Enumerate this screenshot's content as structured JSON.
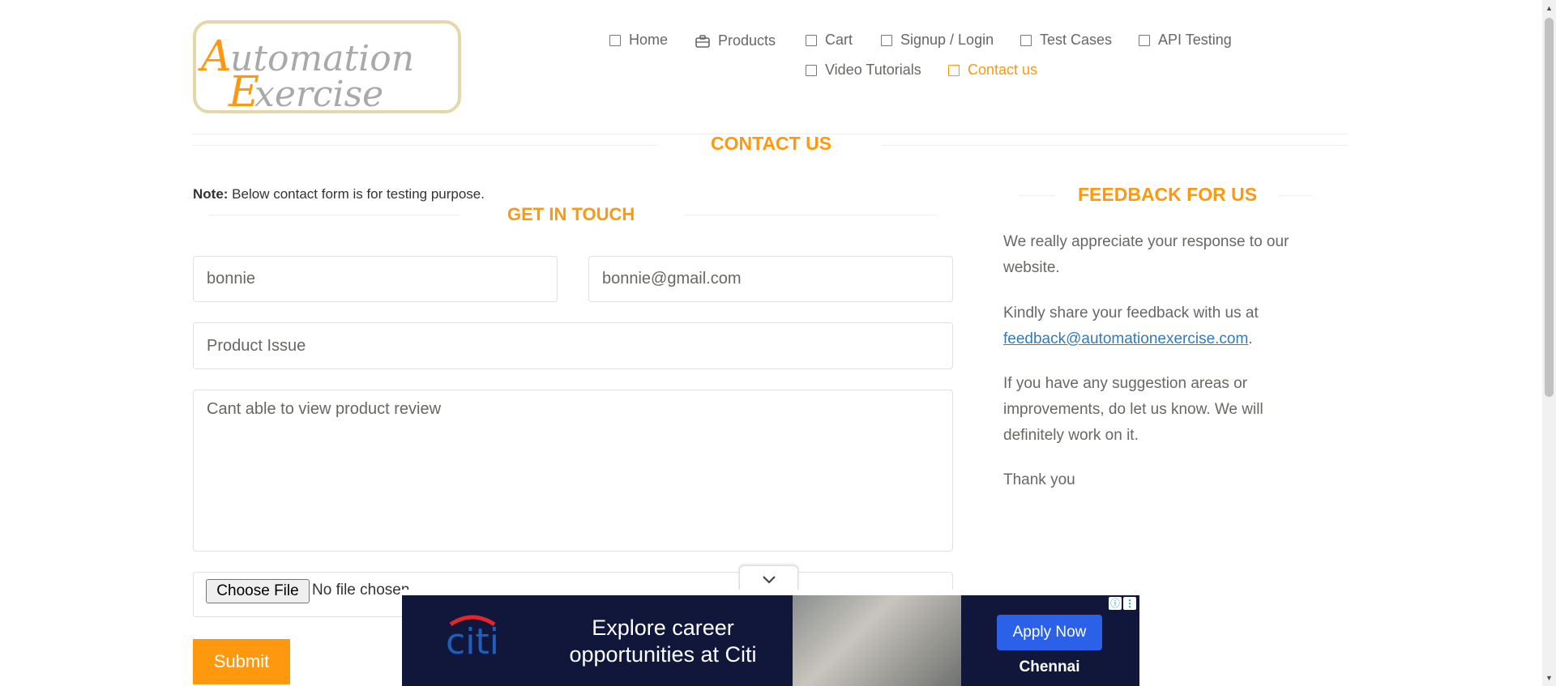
{
  "logo": {
    "line1": "Automation",
    "line2": "Exercise"
  },
  "nav": {
    "home": "Home",
    "products": "Products",
    "cart": "Cart",
    "signup": "Signup / Login",
    "test_cases": "Test Cases",
    "api_testing": "API Testing",
    "video_tutorials": "Video Tutorials",
    "contact_us": "Contact us"
  },
  "page": {
    "title": "CONTACT US",
    "note_label": "Note:",
    "note_text": " Below contact form is for testing purpose."
  },
  "form": {
    "heading": "GET IN TOUCH",
    "name_value": "bonnie",
    "email_value": "bonnie@gmail.com",
    "subject_value": "Product Issue",
    "message_value": "Cant able to view product review",
    "file_button": "Choose File",
    "file_status": "No file chosen",
    "submit_label": "Submit"
  },
  "feedback": {
    "heading": "FEEDBACK FOR US",
    "p1": "We really appreciate your response to our website.",
    "p2_prefix": "Kindly share your feedback with us at",
    "p2_email": "feedback@automationexercise.com",
    "p2_suffix": ".",
    "p3": "If you have any suggestion areas or improvements, do let us know. We will definitely work on it.",
    "p4": "Thank you"
  },
  "ad": {
    "brand": "citi",
    "headline": "Explore career opportunities at Citi",
    "cta": "Apply Now",
    "city": "Chennai",
    "colors": {
      "background": "#10173b",
      "cta": "#2a61e8",
      "brand_red": "#e3262a",
      "brand_blue": "#1f5ebd"
    }
  },
  "colors": {
    "accent": "#fe980f",
    "text": "#696763",
    "link": "#337ab7"
  }
}
